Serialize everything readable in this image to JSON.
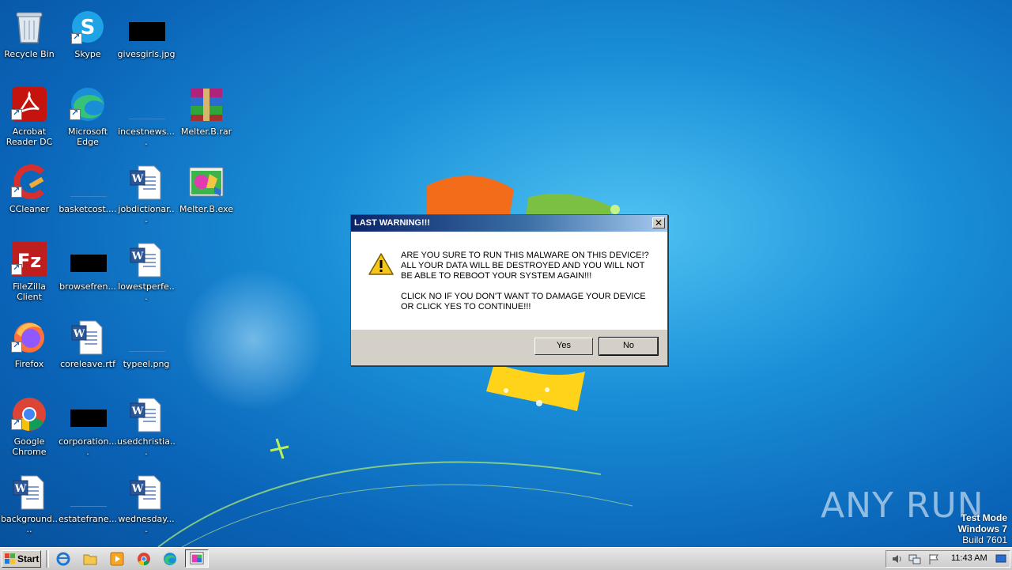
{
  "desktop": {
    "icons": [
      {
        "label": "Recycle Bin",
        "icon": "recycle-bin-icon"
      },
      {
        "label": "Skype",
        "icon": "skype-icon"
      },
      {
        "label": "givesgirls.jpg",
        "icon": "image-file-icon"
      },
      {
        "label": "Acrobat Reader DC",
        "icon": "acrobat-icon"
      },
      {
        "label": "Microsoft Edge",
        "icon": "edge-icon"
      },
      {
        "label": "incestnews....",
        "icon": "image-file-icon"
      },
      {
        "label": "Melter.B.rar",
        "icon": "winrar-archive-icon"
      },
      {
        "label": "CCleaner",
        "icon": "ccleaner-icon"
      },
      {
        "label": "basketcost....",
        "icon": "image-file-icon"
      },
      {
        "label": "jobdictionar...",
        "icon": "word-document-icon"
      },
      {
        "label": "Melter.B.exe",
        "icon": "executable-icon"
      },
      {
        "label": "FileZilla Client",
        "icon": "filezilla-icon"
      },
      {
        "label": "browsefren...",
        "icon": "image-file-icon"
      },
      {
        "label": "lowestperfe...",
        "icon": "word-document-icon"
      },
      {
        "label": "Firefox",
        "icon": "firefox-icon"
      },
      {
        "label": "coreleave.rtf",
        "icon": "word-document-icon"
      },
      {
        "label": "typeel.png",
        "icon": "image-file-icon"
      },
      {
        "label": "Google Chrome",
        "icon": "chrome-icon"
      },
      {
        "label": "corporation....",
        "icon": "image-file-icon"
      },
      {
        "label": "usedchristia...",
        "icon": "word-document-icon"
      },
      {
        "label": "background....",
        "icon": "word-document-icon"
      },
      {
        "label": "estatefrane...",
        "icon": "image-file-icon"
      },
      {
        "label": "wednesday....",
        "icon": "word-document-icon"
      }
    ]
  },
  "dialog": {
    "title": "LAST WARNING!!!",
    "message_line1": "ARE YOU SURE TO RUN THIS MALWARE ON THIS DEVICE!?",
    "message_line2": "ALL YOUR DATA WILL BE DESTROYED AND YOU WILL NOT BE ABLE TO REBOOT YOUR SYSTEM AGAIN!!!",
    "message_line3": "CLICK NO IF YOU DON'T WANT TO DAMAGE YOUR DEVICE OR CLICK YES TO CONTINUE!!!",
    "yes_label": "Yes",
    "no_label": "No",
    "close_glyph": "✕"
  },
  "watermark": {
    "text": "ANY RUN"
  },
  "testmode": {
    "line1": "Test Mode",
    "line2": "Windows 7",
    "line3": "Build 7601"
  },
  "taskbar": {
    "start_label": "Start",
    "clock": "11:43 AM",
    "pinned": [
      "internet-explorer-icon",
      "explorer-folder-icon",
      "media-player-icon",
      "chrome-icon",
      "edge-icon"
    ]
  }
}
